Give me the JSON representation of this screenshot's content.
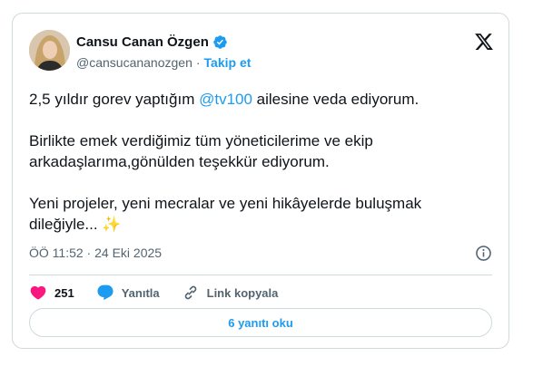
{
  "author": {
    "name": "Cansu Canan Özgen",
    "handle": "@cansucananozgen",
    "separator": "·",
    "follow_label": "Takip et"
  },
  "post": {
    "line1_prefix": "2,5 yıldır gorev yaptığım ",
    "mention": "@tv100",
    "line1_suffix": " ailesine veda ediyorum.",
    "paragraph2": "Birlikte emek verdiğimiz tüm yöneticilerime ve ekip arkadaşlarıma,gönülden teşekkür ediyorum.",
    "paragraph3": "Yeni projeler, yeni mecralar ve yeni hikâyelerde buluşmak dileğiyle... ✨"
  },
  "meta": {
    "timestamp": "ÖÖ 11:52 · 24 Eki 2025"
  },
  "actions": {
    "like_count": "251",
    "reply_label": "Yanıtla",
    "copy_link_label": "Link kopyala"
  },
  "footer": {
    "read_replies_label": "6 yanıtı oku"
  },
  "colors": {
    "accent": "#1d9bf0",
    "like": "#f91880",
    "muted": "#536471",
    "border": "#cfd9de"
  }
}
